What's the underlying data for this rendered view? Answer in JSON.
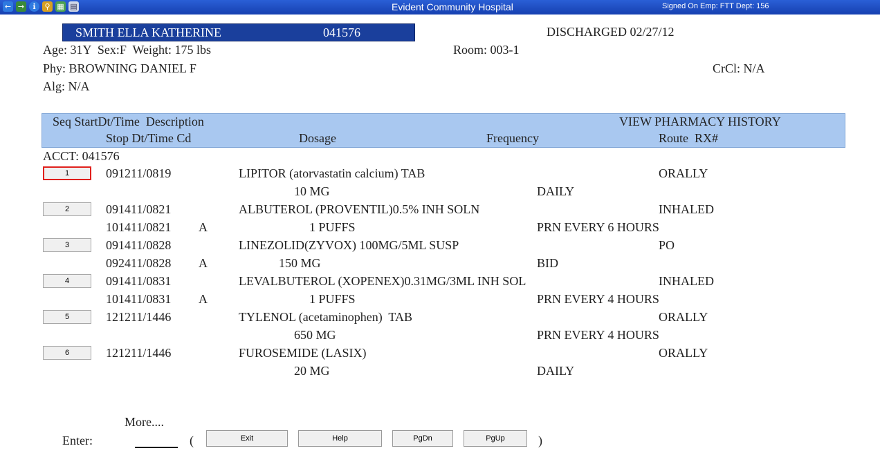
{
  "window": {
    "title": "Evident Community Hospital",
    "signed_on": "Signed On Emp: FTT  Dept: 156",
    "toolbar_icons": [
      "back-arrow-icon",
      "forward-arrow-icon",
      "info-icon",
      "key-icon",
      "chart-icon",
      "document-icon"
    ]
  },
  "patient": {
    "name": "SMITH ELLA KATHERINE",
    "mrn": "041576",
    "status": "DISCHARGED 02/27/12",
    "age_sex_weight": "Age: 31Y  Sex:F  Weight: 175 lbs",
    "room": "Room: 003-1",
    "physician": "Phy: BROWNING DANIEL F",
    "crcl": "CrCl: N/A",
    "allergy": "Alg: N/A"
  },
  "table_header": {
    "row1_left": "Seq StartDt/Time  Description",
    "row1_right": "VIEW PHARMACY HISTORY",
    "row2_stop": "Stop Dt/Time Cd",
    "row2_dosage": "Dosage",
    "row2_frequency": "Frequency",
    "row2_route": "Route  RX#"
  },
  "account": "ACCT: 041576",
  "orders": [
    {
      "seq": "1",
      "start": "091211/0819",
      "description": "LIPITOR (atorvastatin calcium) TAB",
      "route": "ORALLY",
      "stop": "",
      "cd": "",
      "dosage": "10 MG",
      "frequency": "DAILY",
      "selected": true
    },
    {
      "seq": "2",
      "start": "091411/0821",
      "description": "ALBUTEROL (PROVENTIL)0.5% INH SOLN",
      "route": "INHALED",
      "stop": "101411/0821",
      "cd": "A",
      "dosage": "1 PUFFS",
      "frequency": "PRN EVERY 6 HOURS",
      "selected": false
    },
    {
      "seq": "3",
      "start": "091411/0828",
      "description": "LINEZOLID(ZYVOX) 100MG/5ML SUSP",
      "route": "PO",
      "stop": "092411/0828",
      "cd": "A",
      "dosage": "150 MG",
      "frequency": "BID",
      "selected": false
    },
    {
      "seq": "4",
      "start": "091411/0831",
      "description": "LEVALBUTEROL (XOPENEX)0.31MG/3ML INH SOL",
      "route": "INHALED",
      "stop": "101411/0831",
      "cd": "A",
      "dosage": "1 PUFFS",
      "frequency": "PRN EVERY 4 HOURS",
      "selected": false
    },
    {
      "seq": "5",
      "start": "121211/1446",
      "description": "TYLENOL (acetaminophen)  TAB",
      "route": "ORALLY",
      "stop": "",
      "cd": "",
      "dosage": "650 MG",
      "frequency": "PRN EVERY 4 HOURS",
      "selected": false
    },
    {
      "seq": "6",
      "start": "121211/1446",
      "description": "FUROSEMIDE (LASIX)",
      "route": "ORALLY",
      "stop": "",
      "cd": "",
      "dosage": "20 MG",
      "frequency": "DAILY",
      "selected": false
    }
  ],
  "footer": {
    "more": "More....",
    "enter_label": "Enter:",
    "open_paren": "(",
    "close_paren": ")",
    "buttons": [
      {
        "label": "Exit"
      },
      {
        "label": "Help"
      },
      {
        "label": "PgDn"
      },
      {
        "label": "PgUp"
      }
    ]
  },
  "colors": {
    "titlebar": "#1a4fc4",
    "patient_box": "#1a3f9c",
    "header_bg": "#a9c8f0",
    "selected_border": "#e0201c"
  }
}
